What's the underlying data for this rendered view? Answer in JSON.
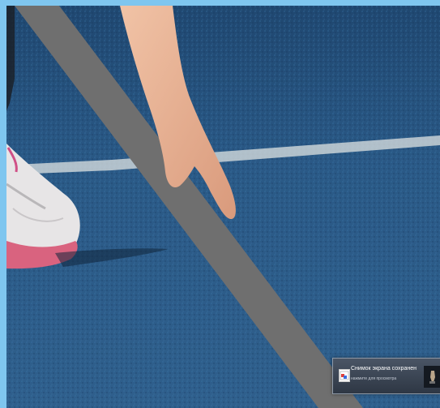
{
  "notification": {
    "title": "Снимок экрана сохранен",
    "subtitle": "нажмите для просмотра",
    "app_icon": "screenshot-app-icon",
    "thumbnail_icon": "screenshot-thumbnail"
  },
  "colors": {
    "desktop_background": "#7fc6ef",
    "track_surface": "#2d5b86",
    "lane_line": "#e4e6e4",
    "start_line": "#6e6e6e",
    "toast_background": "#3b4553"
  }
}
